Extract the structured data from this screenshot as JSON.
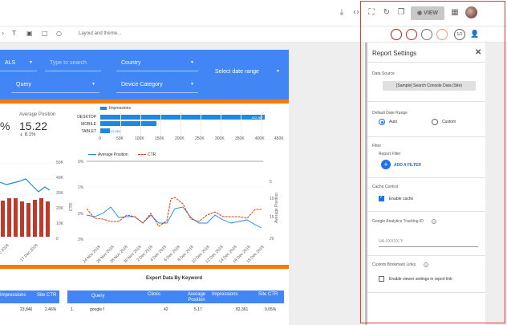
{
  "toolbar": {
    "layout_theme": "Layout and theme...",
    "view_label": "VIEW",
    "color_circles": [
      "#b71c1c",
      "#c62828",
      "#757575",
      "#9e9e9e",
      "#ef9a73"
    ],
    "user_count": "1/1"
  },
  "filters": {
    "query_label": "Query",
    "country_label": "Country",
    "device_label": "Device Category",
    "date_label": "Select date range",
    "search_placeholder": "Type to search",
    "partial_label": "ALS"
  },
  "scorecards": {
    "pct_fragment": "%",
    "avg_position_label": "Average Position",
    "avg_position_value": "15.22",
    "avg_position_delta": "⇣ 8.1%"
  },
  "device_bar": {
    "legend": "Impressions",
    "categories": [
      "DESKTOP",
      "MOBILE",
      "TABLET"
    ],
    "values": [
      "422,367",
      "143,858",
      "23,964"
    ],
    "ticks": [
      "0",
      "50K",
      "100K",
      "150K",
      "200K",
      "250K",
      "300K",
      "350K",
      "400K",
      "450K"
    ]
  },
  "left_chart": {
    "yticks": [
      "50K",
      "40K",
      "30K",
      "20K",
      "10K",
      "0"
    ],
    "xticks": [
      "10 Dec 2018",
      "17 Dec 2018"
    ]
  },
  "line_chart": {
    "legend_a": "Average Position",
    "legend_b": "CTR",
    "left_axis": "CTR",
    "right_axis": "Average Position",
    "left_ticks": [
      "0%",
      "1%",
      "2%",
      "3%",
      "4%"
    ],
    "right_ticks": [
      "5",
      "10",
      "15",
      "20"
    ],
    "xticks": [
      "24 Nov 2018",
      "26 Nov 2018",
      "28 Nov 2018",
      "30 Nov 2018",
      "2 Dec 2018",
      "4 Dec 2018",
      "6 Dec 2018",
      "8 Dec 2018",
      "10 Dec 2018",
      "12 Dec 2018",
      "14 Dec 2018",
      "16 Dec 2018",
      "18 Dec 2018"
    ]
  },
  "export_table": {
    "title": "Export Data By Keyword",
    "left_headers": [
      "Impressions",
      "Site CTR"
    ],
    "left_row": [
      "23,846",
      "2.46%"
    ],
    "headers": [
      "Query",
      "Clicks",
      "Average Position",
      "Impressions",
      "Site CTR"
    ],
    "row": [
      "1.",
      "google f",
      "42",
      "5.17",
      "82,361",
      "0.05%"
    ]
  },
  "panel": {
    "title": "Report Settings",
    "data_source_label": "Data Source",
    "data_source_value": "[Sample] Search Console Data (Site)",
    "date_range_label": "Default Date Range",
    "auto_label": "Auto",
    "custom_label": "Custom",
    "filter_label": "Filter",
    "report_filter_label": "Report Filter",
    "add_filter_label": "ADD A FILTER",
    "cache_label": "Cache Control",
    "enable_cache_label": "Enable cache",
    "ga_label": "Google Analytics Tracking ID",
    "ga_placeholder": "UA-XXXXX-Y",
    "bookmark_label": "Custom Bookmark Links",
    "bookmark_option": "Enable viewer settings in report link"
  }
}
